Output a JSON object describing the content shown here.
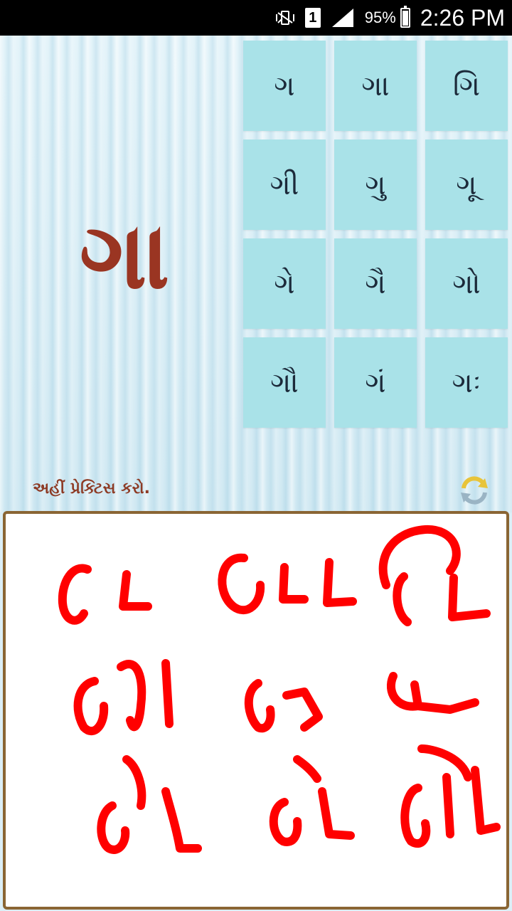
{
  "status_bar": {
    "mute_icon": "vibrate-mute-icon",
    "sim_label": "1",
    "battery_text": "95%",
    "battery_level_percent": 95,
    "time": "2:26 PM"
  },
  "main": {
    "current_letter": "ગા",
    "syllables": [
      "ગ",
      "ગા",
      "ગિ",
      "ગી",
      "ગુ",
      "ગૂ",
      "ગે",
      "ગૈ",
      "ગો",
      "ગૌ",
      "ગં",
      "ગઃ"
    ]
  },
  "practice": {
    "label": "અહીં પ્રેક્ટિસ કરો.",
    "refresh_icon": "refresh-icon",
    "stroke_color": "#ff0000",
    "border_color": "#8a6534"
  },
  "colors": {
    "letter": "#9a3522",
    "cell_bg": "#a9e2e8",
    "label": "#8d3a24"
  }
}
